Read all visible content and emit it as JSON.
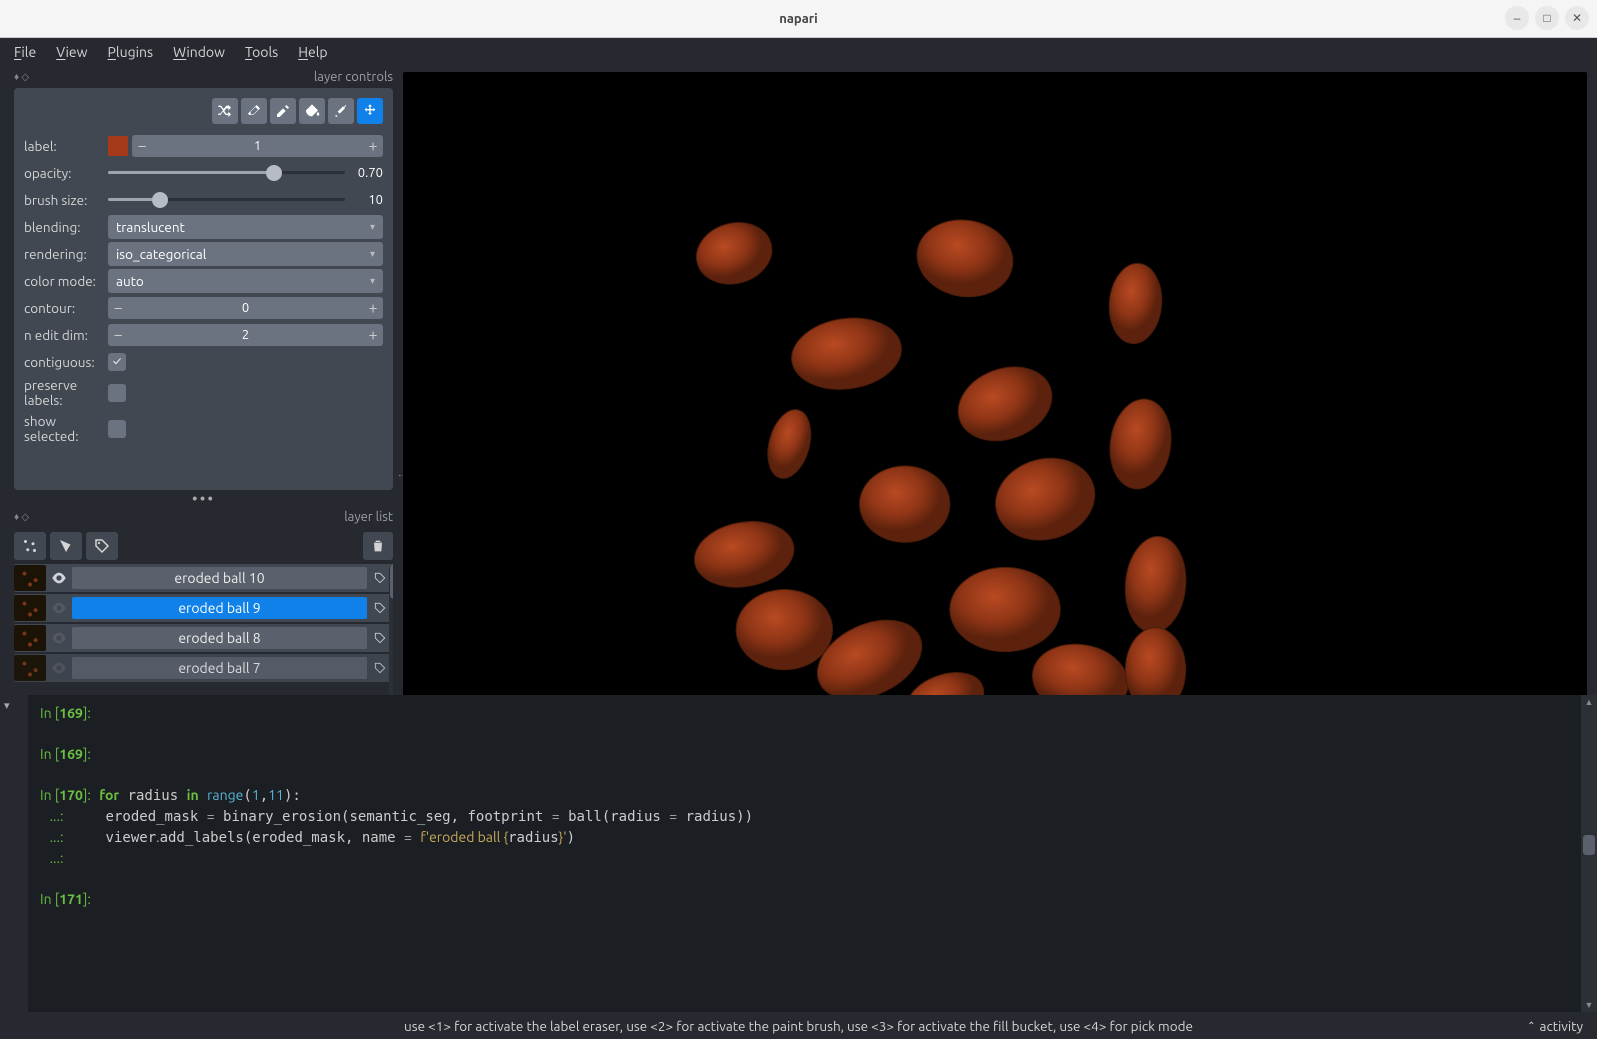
{
  "window": {
    "title": "napari"
  },
  "menu": {
    "file": "File",
    "view": "View",
    "plugins": "Plugins",
    "window": "Window",
    "tools": "Tools",
    "help": "Help"
  },
  "panels": {
    "controls": "layer controls",
    "list": "layer list"
  },
  "controls": {
    "label": {
      "label": "label:",
      "value": "1"
    },
    "opacity": {
      "label": "opacity:",
      "value": "0.70",
      "pct": 70
    },
    "brush": {
      "label": "brush size:",
      "value": "10",
      "pct": 22
    },
    "blending": {
      "label": "blending:",
      "value": "translucent"
    },
    "rendering": {
      "label": "rendering:",
      "value": "iso_categorical"
    },
    "colormode": {
      "label": "color mode:",
      "value": "auto"
    },
    "contour": {
      "label": "contour:",
      "value": "0"
    },
    "neditdim": {
      "label": "n edit dim:",
      "value": "2"
    },
    "contiguous": {
      "label": "contiguous:",
      "checked": true
    },
    "preserve": {
      "label": "preserve labels:",
      "checked": false
    },
    "showsel": {
      "label": "show selected:",
      "checked": false
    }
  },
  "layers": [
    {
      "name": "eroded ball 10",
      "visible": true,
      "selected": false
    },
    {
      "name": "eroded ball 9",
      "visible": false,
      "selected": true
    },
    {
      "name": "eroded ball 8",
      "visible": false,
      "selected": false
    },
    {
      "name": "eroded ball 7",
      "visible": false,
      "selected": false
    }
  ],
  "console": {
    "lines": [
      {
        "p": "In [169]:",
        "c": ""
      },
      {
        "p": "",
        "c": ""
      },
      {
        "p": "In [169]:",
        "c": ""
      },
      {
        "p": "",
        "c": ""
      },
      {
        "p": "In [170]:",
        "c": " for radius in range(1,11):"
      },
      {
        "p": "   ...:",
        "c": "     eroded_mask = binary_erosion(semantic_seg, footprint = ball(radius = radius))"
      },
      {
        "p": "   ...:",
        "c": "     viewer.add_labels(eroded_mask, name = f'eroded ball {radius}')"
      },
      {
        "p": "   ...:",
        "c": ""
      },
      {
        "p": "",
        "c": ""
      },
      {
        "p": "In [171]:",
        "c": ""
      }
    ]
  },
  "status": {
    "hint": "use <1> for activate the label eraser, use <2> for activate the paint brush, use <3> for activate the fill bucket, use <4> for pick mode",
    "activity": "activity"
  },
  "colors": {
    "accent": "#0f81e8",
    "blob": "#a63a18",
    "blob_dark": "#6d2610"
  }
}
